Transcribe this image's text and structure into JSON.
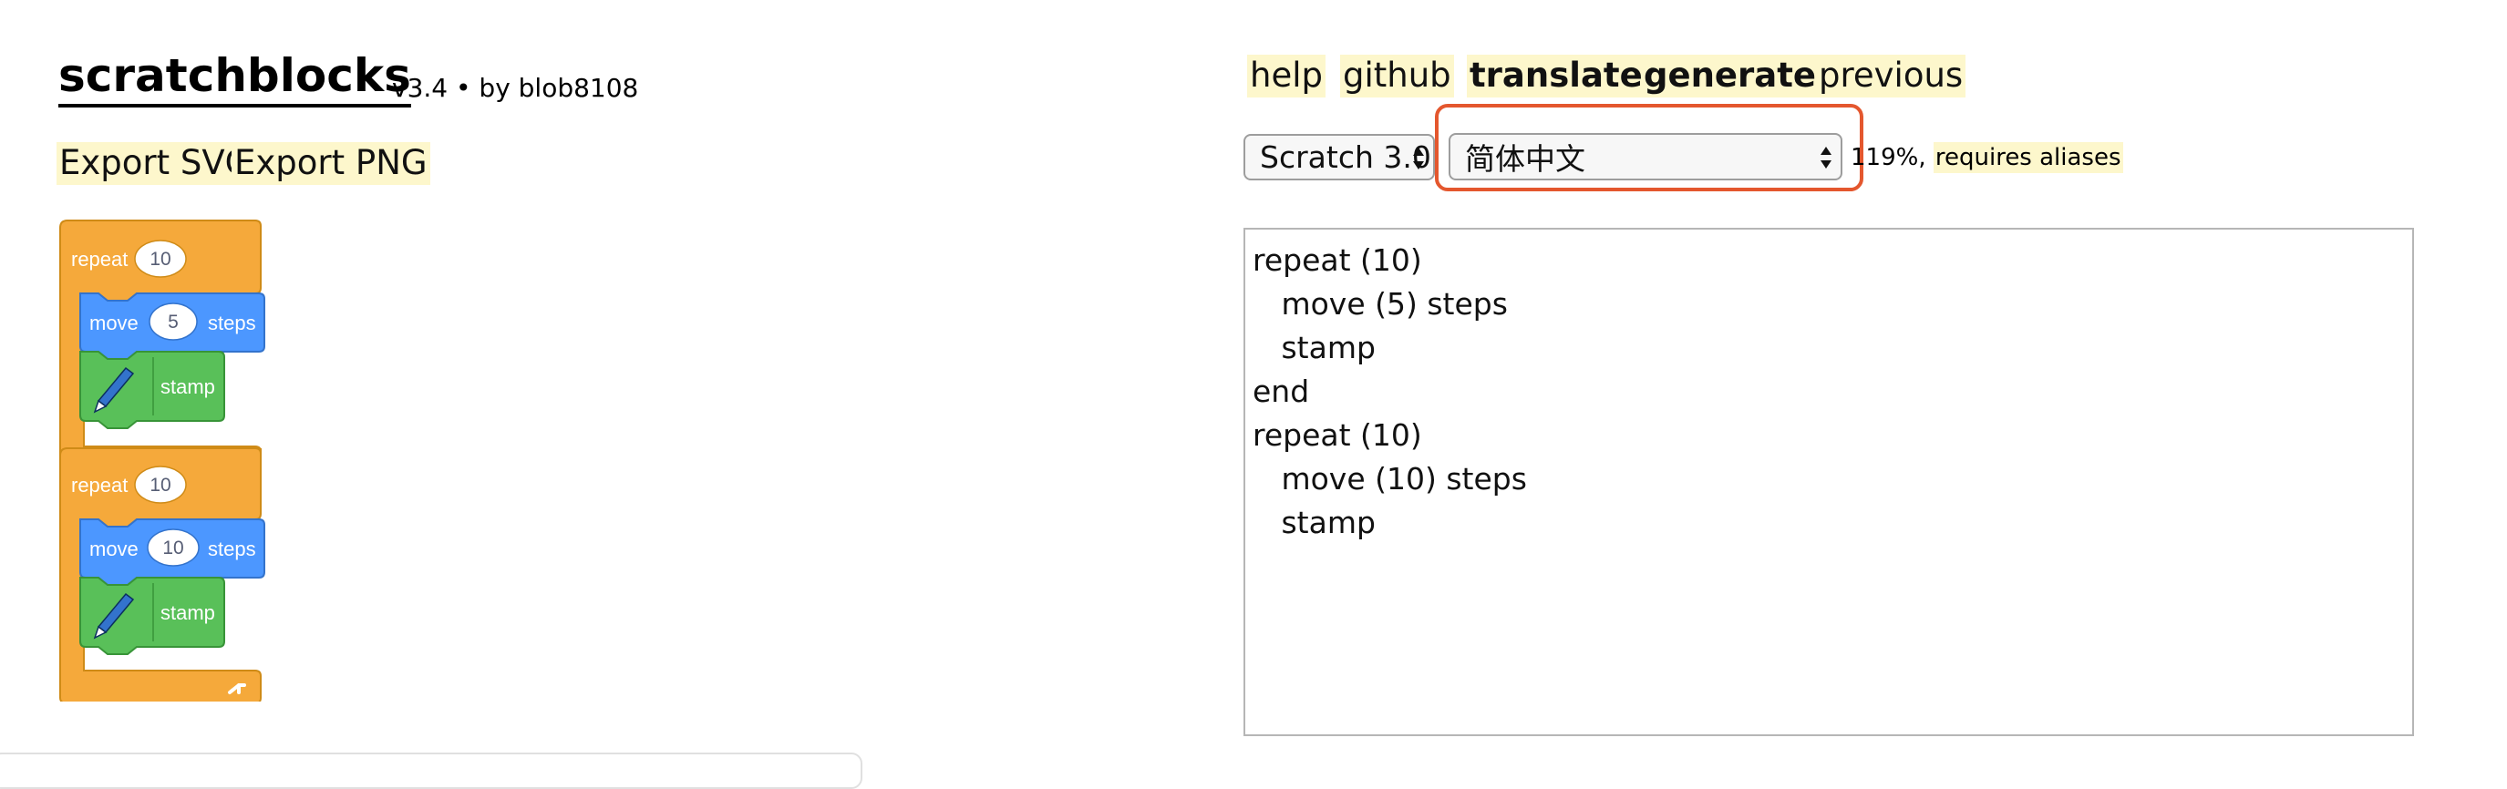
{
  "header": {
    "title": "scratchblocks",
    "version": "v3.4 • by blob8108",
    "export_svg": "Export SVG",
    "export_png": "Export PNG"
  },
  "nav": {
    "help": "help",
    "github": "github",
    "translate": "translate",
    "generate": "generate",
    "previous": "previous"
  },
  "controls": {
    "version_select": "Scratch 3.0",
    "language_select": "简体中文",
    "zoom_prefix": "119%, ",
    "aliases_link": "requires aliases"
  },
  "editor": {
    "lines": [
      "repeat (10)",
      "   move (5) steps",
      "   stamp",
      "end",
      "repeat (10)",
      "   move (10) steps",
      "   stamp"
    ]
  },
  "blocks": {
    "stack1": {
      "repeat_label": "repeat",
      "repeat_count": "10",
      "move_label": "move",
      "move_value": "5",
      "steps_label": "steps",
      "stamp_label": "stamp"
    },
    "stack2": {
      "repeat_label": "repeat",
      "repeat_count": "10",
      "move_label": "move",
      "move_value": "10",
      "steps_label": "steps",
      "stamp_label": "stamp"
    }
  },
  "colors": {
    "control": "#f5a93b",
    "motion": "#4c97ff",
    "pen": "#59c059",
    "highlight": "#fdf7cc",
    "annotation": "#e4572e"
  },
  "icons": {
    "pen": "pen-icon",
    "loop": "loop-arrow-icon"
  }
}
